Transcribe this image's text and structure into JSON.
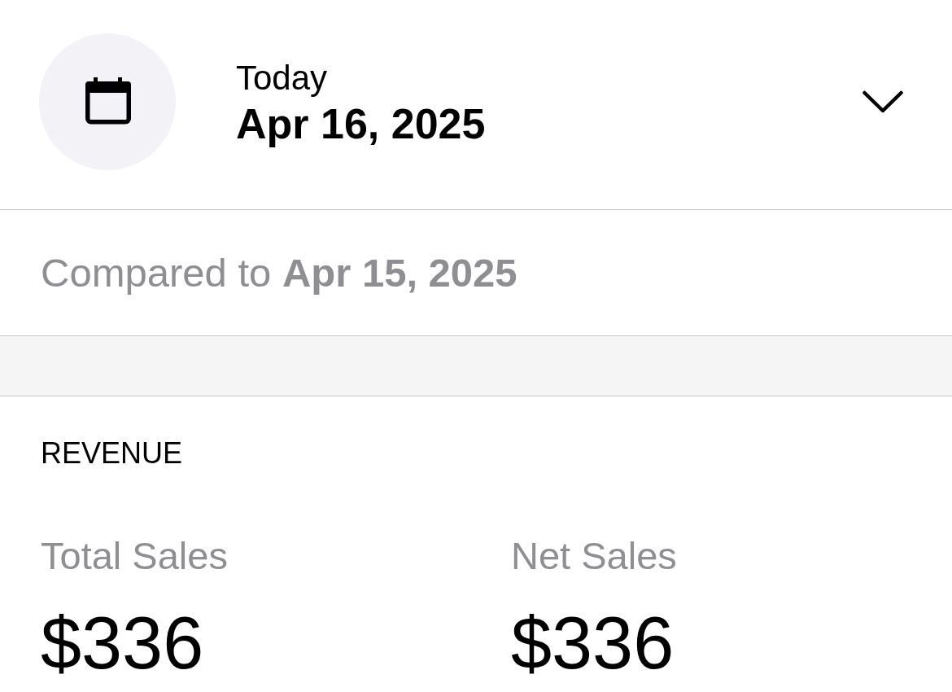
{
  "date_picker": {
    "label": "Today",
    "date": "Apr 16, 2025"
  },
  "comparison": {
    "text": "Compared to **Apr 15, 2025**"
  },
  "revenue": {
    "title": "REVENUE",
    "metrics": [
      {
        "label": "Total Sales",
        "value": "$336"
      },
      {
        "label": "Net Sales",
        "value": "$336"
      }
    ]
  }
}
